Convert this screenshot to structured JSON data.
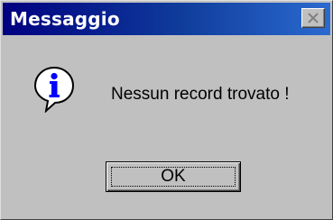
{
  "window": {
    "title": "Messaggio"
  },
  "message": {
    "text": "Nessun record trovato !",
    "icon": "info-icon"
  },
  "buttons": {
    "ok_label": "OK",
    "close_icon": "close-icon"
  },
  "colors": {
    "titlebar_start": "#000080",
    "titlebar_end": "#2b6ad0",
    "dialog_face": "#c0c0c0",
    "icon_blue": "#0000ff"
  }
}
